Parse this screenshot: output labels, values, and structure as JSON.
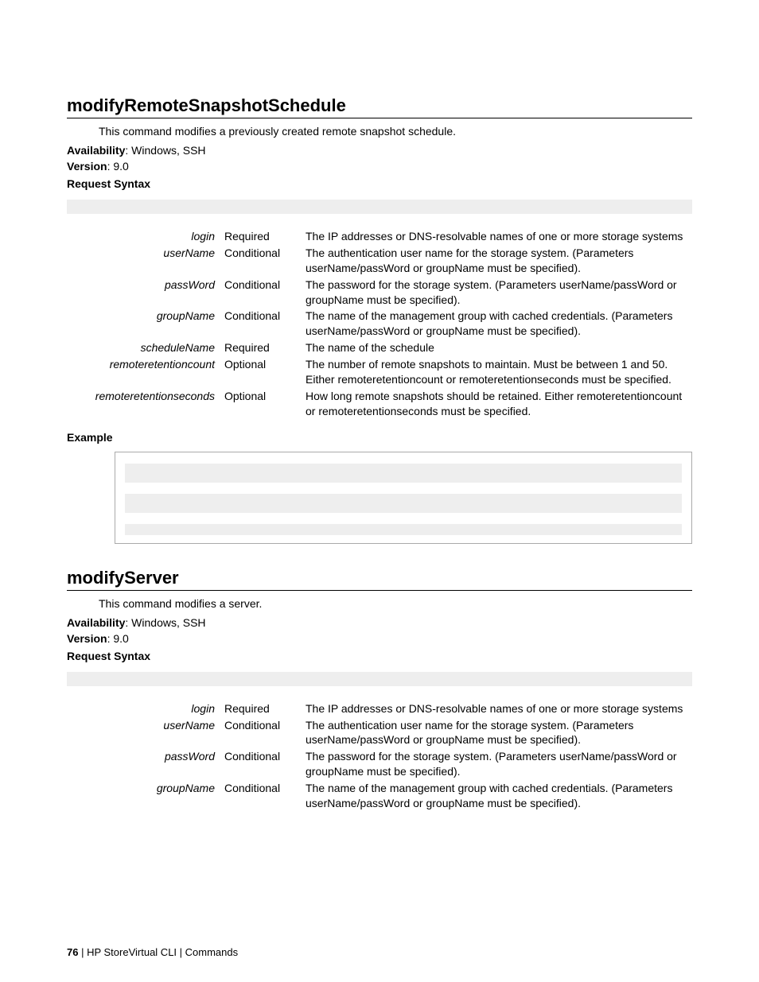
{
  "sections": [
    {
      "title": "modifyRemoteSnapshotSchedule",
      "intro": "This command modifies a previously created remote snapshot schedule.",
      "availability_label": "Availability",
      "availability_value": ": Windows, SSH",
      "version_label": "Version",
      "version_value": ": 9.0",
      "request_syntax_label": "Request Syntax",
      "params": [
        {
          "name": "login",
          "req": "Required",
          "desc": "The IP addresses or DNS-resolvable names of one or more storage systems"
        },
        {
          "name": "userName",
          "req": "Conditional",
          "desc": "The authentication user name for the storage system. (Parameters userName/passWord or groupName must be specified)."
        },
        {
          "name": "passWord",
          "req": "Conditional",
          "desc": "The password for the storage system. (Parameters userName/passWord or groupName must be specified)."
        },
        {
          "name": "groupName",
          "req": "Conditional",
          "desc": "The name of the management group with cached credentials. (Parameters userName/passWord or groupName must be specified)."
        },
        {
          "name": "scheduleName",
          "req": "Required",
          "desc": "The name of the schedule"
        },
        {
          "name": "remoteretentioncount",
          "req": "Optional",
          "desc": "The number of remote snapshots to maintain. Must be between 1 and 50. Either remoteretentioncount or remoteretentionseconds must be specified."
        },
        {
          "name": "remoteretentionseconds",
          "req": "Optional",
          "desc": "How long remote snapshots should be retained. Either remoteretentioncount or remoteretentionseconds must be specified."
        }
      ],
      "example_label": "Example",
      "has_example": true
    },
    {
      "title": "modifyServer",
      "intro": "This command modifies a server.",
      "availability_label": "Availability",
      "availability_value": ": Windows, SSH",
      "version_label": "Version",
      "version_value": ": 9.0",
      "request_syntax_label": "Request Syntax",
      "params": [
        {
          "name": "login",
          "req": "Required",
          "desc": "The IP addresses or DNS-resolvable names of one or more storage systems"
        },
        {
          "name": "userName",
          "req": "Conditional",
          "desc": "The authentication user name for the storage system. (Parameters userName/passWord or groupName must be specified)."
        },
        {
          "name": "passWord",
          "req": "Conditional",
          "desc": "The password for the storage system. (Parameters userName/passWord or groupName must be specified)."
        },
        {
          "name": "groupName",
          "req": "Conditional",
          "desc": "The name of the management group with cached credentials. (Parameters userName/passWord or groupName must be specified)."
        }
      ],
      "has_example": false
    }
  ],
  "footer": {
    "page_number": "76",
    "sep1": " |  ",
    "doc_title": "HP StoreVirtual CLI",
    "sep2": "  |    ",
    "chapter": "Commands"
  }
}
